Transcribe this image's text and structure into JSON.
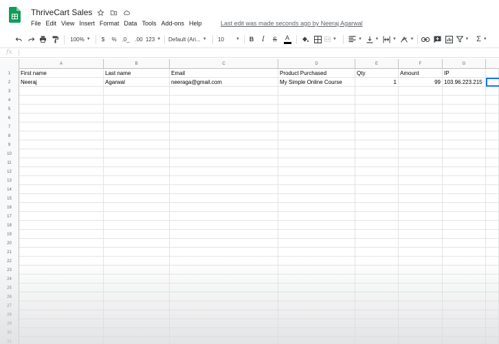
{
  "document": {
    "title": "ThriveCart Sales",
    "last_edit": "Last edit was made seconds ago by Neeraj Agarwal"
  },
  "menu": [
    "File",
    "Edit",
    "View",
    "Insert",
    "Format",
    "Data",
    "Tools",
    "Add-ons",
    "Help"
  ],
  "toolbar": {
    "zoom": "100%",
    "currency": "$",
    "percent": "%",
    "decrease_decimals": ".0_",
    "increase_decimals": ".00",
    "more_formats": "123",
    "font": "Default (Ari...",
    "font_size": "10",
    "bold": "B",
    "italic": "I",
    "strikethrough": "S",
    "text_color": "A"
  },
  "formula_bar": {
    "label": "fx",
    "value": ""
  },
  "sheet": {
    "columns": [
      "A",
      "B",
      "C",
      "D",
      "E",
      "F",
      "G"
    ],
    "row_numbers": [
      "1",
      "2",
      "3",
      "4",
      "5",
      "6",
      "7",
      "8",
      "9",
      "10",
      "11",
      "12",
      "13",
      "14",
      "15",
      "16",
      "17",
      "18",
      "19",
      "20",
      "21",
      "22",
      "23",
      "24",
      "25",
      "26",
      "27",
      "28",
      "29",
      "30",
      "31"
    ],
    "header_row": [
      "First name",
      "Last name",
      "Email",
      "Product Purchased",
      "Qty",
      "Amount",
      "IP"
    ],
    "data_row": [
      "Neeraj",
      "Agarwal",
      "neeraga@gmail.com",
      "My Simple Online Course",
      "1",
      "99",
      "103.96.223.215"
    ]
  },
  "colors": {
    "accent": "#1a73e8",
    "sheets_green": "#0f9d58",
    "header_bg": "#f8f9fa",
    "gridline": "#e2e3e3"
  },
  "icons": [
    "sheets-logo-icon",
    "star-icon",
    "move-to-folder-icon",
    "cloud-saved-icon",
    "undo-icon",
    "redo-icon",
    "print-icon",
    "paint-format-icon",
    "fill-color-icon",
    "borders-icon",
    "merge-cells-icon",
    "horizontal-align-icon",
    "vertical-align-icon",
    "text-wrap-icon",
    "text-rotate-icon",
    "insert-link-icon",
    "insert-comment-icon",
    "insert-chart-icon",
    "filter-icon",
    "functions-icon"
  ]
}
